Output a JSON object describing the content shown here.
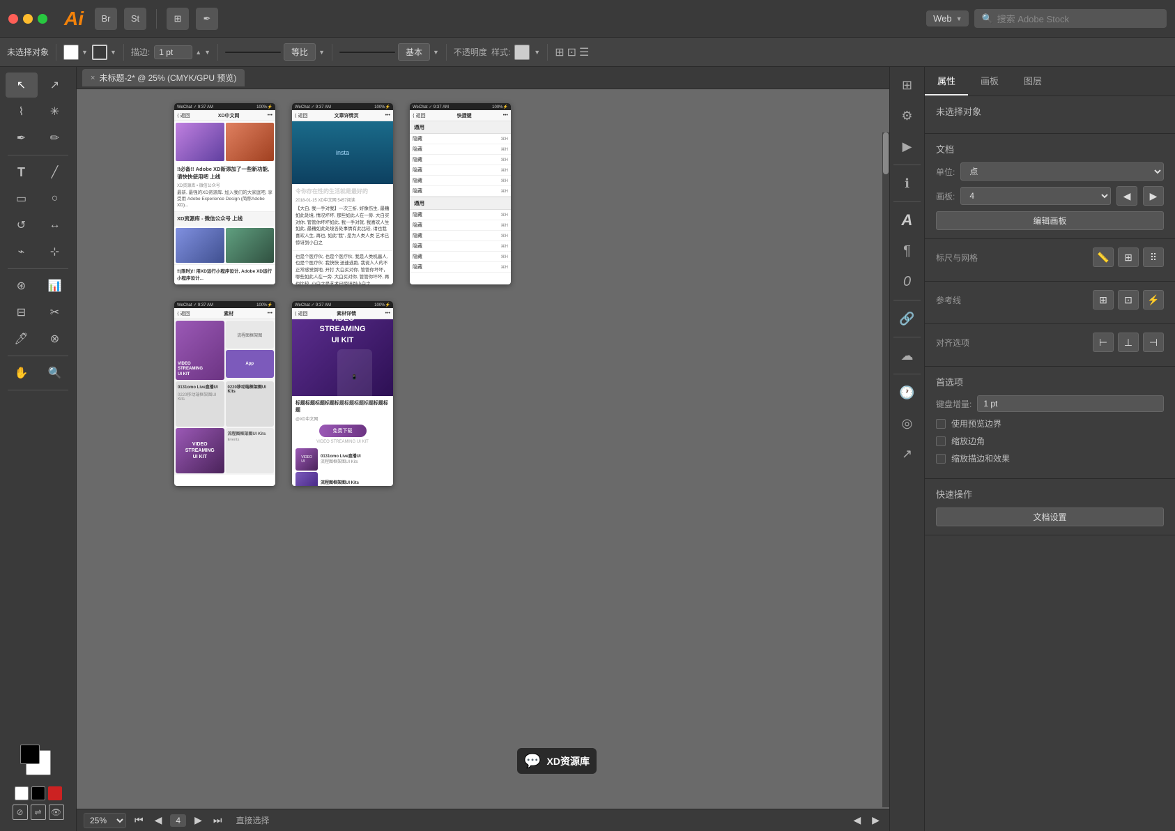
{
  "titlebar": {
    "app_name": "Ai",
    "app_color": "#f3820a",
    "traffic_lights": [
      "red",
      "yellow",
      "green"
    ],
    "icons": [
      "Br",
      "St",
      "grid",
      "pen"
    ],
    "workspace": "Web",
    "search_placeholder": "搜索 Adobe Stock"
  },
  "toolbar": {
    "no_selection": "未选择对象",
    "stroke_label": "描边:",
    "pt_value": "1 pt",
    "ratio_label": "等比",
    "base_label": "基本",
    "opacity_label": "不透明度",
    "style_label": "样式:"
  },
  "canvas": {
    "tab_close": "×",
    "tab_title": "未标题-2* @ 25% (CMYK/GPU 预览)",
    "zoom_value": "25%",
    "artboard_count": "4",
    "status_text": "直接选择"
  },
  "artboards": {
    "top_row": [
      {
        "id": "xd-home",
        "title": "XD中文网",
        "status_bar": "WeChat ✓  9:37 AM   100%",
        "nav_back": "< 返回"
      },
      {
        "id": "article-detail",
        "title": "文章详情页",
        "status_bar": "WeChat ✓  9:37 AM   100%",
        "nav_back": "< 返回"
      },
      {
        "id": "shortcuts",
        "title": "快捷键",
        "status_bar": "WeChat ✓  9:37 AM   100%",
        "nav_back": "< 返回"
      }
    ],
    "bottom_row": [
      {
        "id": "material",
        "title": "素材",
        "status_bar": "WeChat ✓  9:37 AM   100%",
        "nav_back": "< 返回"
      },
      {
        "id": "material-detail",
        "title": "素材详情",
        "status_bar": "WeChat ✓  9:37 AM   100%",
        "nav_back": "< 返回"
      }
    ]
  },
  "right_panel": {
    "tabs": [
      "属性",
      "画板",
      "图层"
    ],
    "active_tab": "属性",
    "no_selection": "未选择对象",
    "doc_section": "文档",
    "unit_label": "单位:",
    "unit_value": "点",
    "artboard_label": "画板:",
    "artboard_value": "4",
    "edit_artboard_btn": "编辑画板",
    "ruler_grid_label": "标尺与网格",
    "guides_label": "参考线",
    "align_label": "对齐选项",
    "preferences_label": "首选项",
    "keyboard_increment_label": "键盘增量:",
    "keyboard_increment_value": "1 pt",
    "use_preview_bounds": "使用预览边界",
    "scale_corners": "缩放边角",
    "scale_strokes": "缩放描边和效果",
    "quick_actions": "快速操作",
    "doc_settings_btn": "文档设置"
  },
  "watermark": {
    "icon": "💬",
    "text": "XD资源库"
  },
  "shortcuts_panel": {
    "sections": [
      {
        "title": "通用",
        "items": [
          {
            "label": "隐藏",
            "shortcut": "⌘H"
          },
          {
            "label": "隐藏",
            "shortcut": "⌘H"
          },
          {
            "label": "隐藏",
            "shortcut": "⌘H"
          },
          {
            "label": "隐藏",
            "shortcut": "⌘H"
          },
          {
            "label": "隐藏",
            "shortcut": "⌘H"
          },
          {
            "label": "隐藏",
            "shortcut": "⌘H"
          }
        ]
      },
      {
        "title": "通用",
        "items": [
          {
            "label": "隐藏",
            "shortcut": "⌘H"
          },
          {
            "label": "隐藏",
            "shortcut": "⌘H"
          },
          {
            "label": "隐藏",
            "shortcut": "⌘H"
          },
          {
            "label": "隐藏",
            "shortcut": "⌘H"
          },
          {
            "label": "隐藏",
            "shortcut": "⌘H"
          },
          {
            "label": "隐藏",
            "shortcut": "⌘H"
          }
        ]
      }
    ]
  }
}
